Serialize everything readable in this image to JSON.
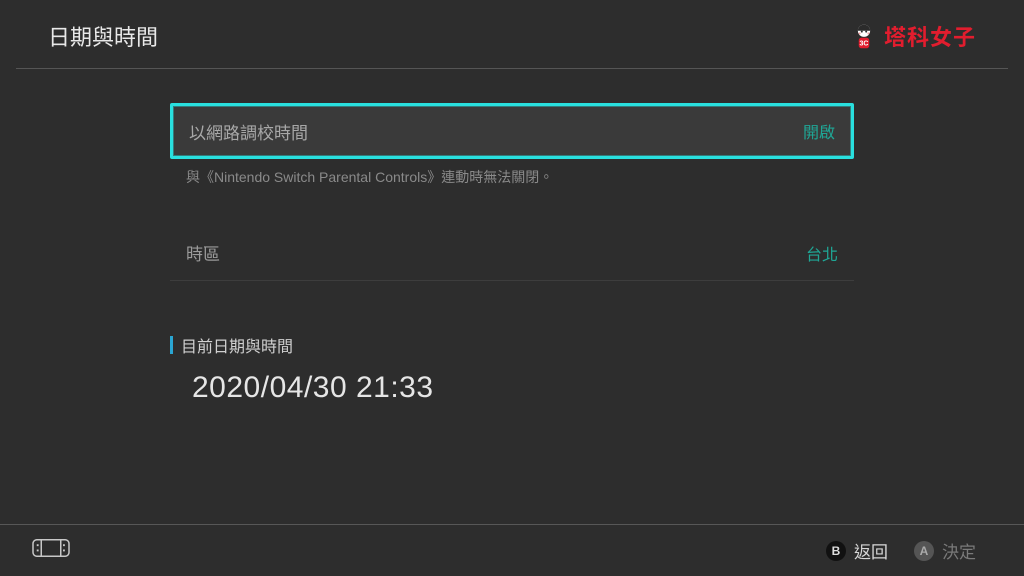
{
  "header": {
    "title": "日期與時間",
    "brand": "塔科女子"
  },
  "rows": {
    "sync": {
      "label": "以網路調校時間",
      "value": "開啟",
      "hint": "與《Nintendo Switch Parental Controls》連動時無法關閉。"
    },
    "timezone": {
      "label": "時區",
      "value": "台北"
    }
  },
  "current": {
    "heading": "目前日期與時間",
    "datetime": "2020/04/30 21:33"
  },
  "footer": {
    "back": {
      "button": "B",
      "label": "返回"
    },
    "confirm": {
      "button": "A",
      "label": "決定"
    }
  }
}
